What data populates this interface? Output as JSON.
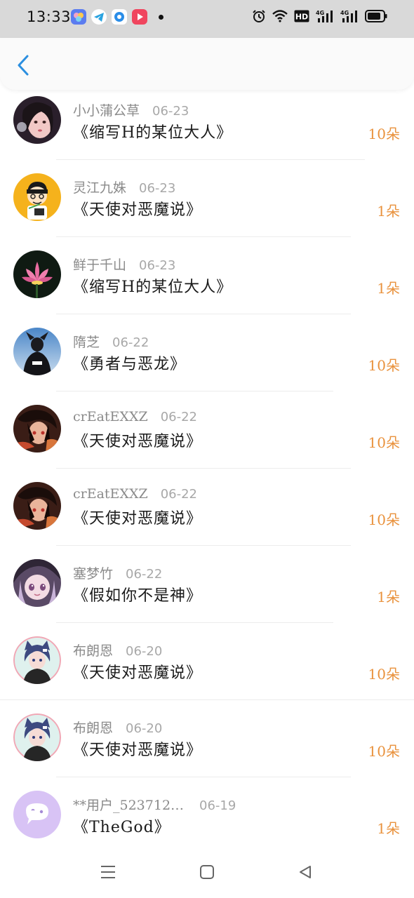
{
  "status_bar": {
    "time": "13:33",
    "app_icons": [
      "gallery-icon",
      "telegram-icon",
      "browser-icon",
      "video-icon"
    ],
    "right_icons": [
      "alarm-icon",
      "wifi-icon",
      "hd-icon",
      "signal-4g-icon",
      "signal-4g-icon",
      "battery-icon"
    ],
    "hd_label": "HD",
    "net_label": "4G"
  },
  "header": {
    "back_icon": "chevron-left-icon",
    "accent": "#2b8fe0"
  },
  "colors": {
    "amount": "#e9923d",
    "username": "#8a8a8a",
    "date": "#a8a8a8"
  },
  "gifts": [
    {
      "user": "小小蒲公草",
      "date": "06-23",
      "book": "《缩写H的某位大人》",
      "amount": "10朵",
      "avatar": "avatar-girl-portrait"
    },
    {
      "user": "灵江九姝",
      "date": "06-23",
      "book": "《天使对恶魔说》",
      "amount": "1朵",
      "avatar": "avatar-cartoon-boy"
    },
    {
      "user": "鲜于千山",
      "date": "06-23",
      "book": "《缩写H的某位大人》",
      "amount": "1朵",
      "avatar": "avatar-lotus-flower"
    },
    {
      "user": "隋芝",
      "date": "06-22",
      "book": "《勇者与恶龙》",
      "amount": "10朵",
      "avatar": "avatar-person-sky"
    },
    {
      "user": "crEatEXXZ",
      "date": "06-22",
      "book": "《天使对恶魔说》",
      "amount": "10朵",
      "avatar": "avatar-anime-dark"
    },
    {
      "user": "crEatEXXZ",
      "date": "06-22",
      "book": "《天使对恶魔说》",
      "amount": "10朵",
      "avatar": "avatar-anime-dark"
    },
    {
      "user": "塞梦竹",
      "date": "06-22",
      "book": "《假如你不是神》",
      "amount": "1朵",
      "avatar": "avatar-anime-girl"
    },
    {
      "user": "布朗恩",
      "date": "06-20",
      "book": "《天使对恶魔说》",
      "amount": "10朵",
      "avatar": "avatar-catboy"
    },
    {
      "user": "布朗恩",
      "date": "06-20",
      "book": "《天使对恶魔说》",
      "amount": "10朵",
      "avatar": "avatar-catboy"
    },
    {
      "user": "**用户_523712…",
      "date": "06-19",
      "book": "《TheGod》",
      "amount": "1朵",
      "avatar": "avatar-default-chat"
    }
  ],
  "nav_bar": {
    "icons": [
      "menu-icon",
      "home-square-icon",
      "back-triangle-icon"
    ]
  }
}
